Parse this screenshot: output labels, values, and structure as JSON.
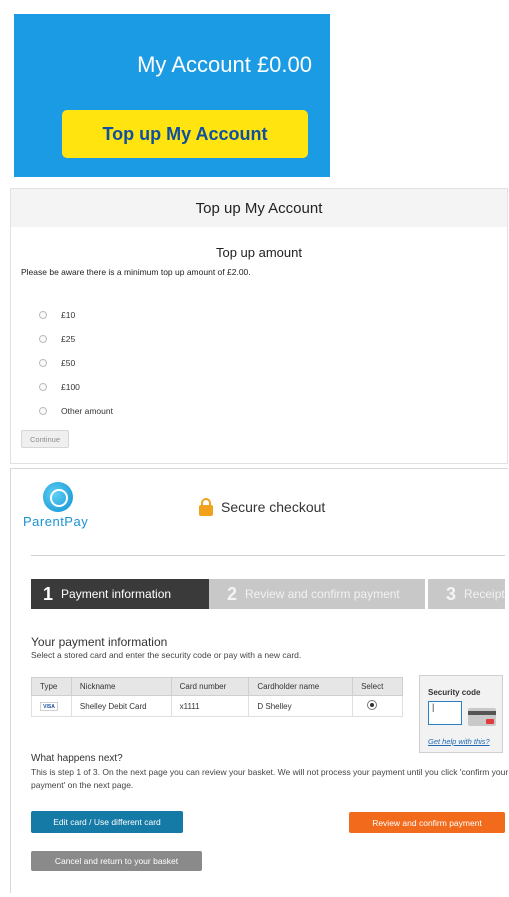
{
  "banner": {
    "account_label": "My Account £0.00",
    "topup_button": "Top up My Account"
  },
  "topup": {
    "heading": "Top up My Account",
    "amount_title": "Top up amount",
    "notice": "Please be aware there is a minimum top up amount of £2.00.",
    "options": [
      "£10",
      "£25",
      "£50",
      "£100",
      "Other amount"
    ],
    "continue_label": "Continue"
  },
  "checkout": {
    "brand": "ParentPay",
    "secure_label": "Secure checkout",
    "lock_icon": "padlock-icon",
    "steps": [
      {
        "num": "1",
        "label": "Payment information"
      },
      {
        "num": "2",
        "label": "Review and confirm payment"
      },
      {
        "num": "3",
        "label": "Receipt"
      }
    ],
    "payment_title": "Your payment information",
    "payment_subtitle": "Select a stored card and enter the security code or pay with a new card.",
    "table": {
      "headers": [
        "Type",
        "Nickname",
        "Card number",
        "Cardholder name",
        "Select"
      ],
      "row": {
        "type": "VISA",
        "nickname": "Shelley Debit Card",
        "card_number": "x1111",
        "cardholder": "D Shelley"
      }
    },
    "security": {
      "label": "Security code",
      "value": "|",
      "help": "Get help with this?"
    },
    "next_title": "What happens next?",
    "next_text": "This is step 1 of 3. On the next page you can review your basket. We will not process your payment until you click 'confirm your payment' on the next page.",
    "buttons": {
      "edit": "Edit card / Use different card",
      "review": "Review and confirm payment",
      "cancel": "Cancel and return to your basket"
    }
  },
  "colors": {
    "banner_blue": "#1a9be4",
    "topup_yellow": "#ffe410",
    "edit_blue": "#157aa6",
    "review_orange": "#f26b1d",
    "cancel_gray": "#8a8a8a"
  }
}
